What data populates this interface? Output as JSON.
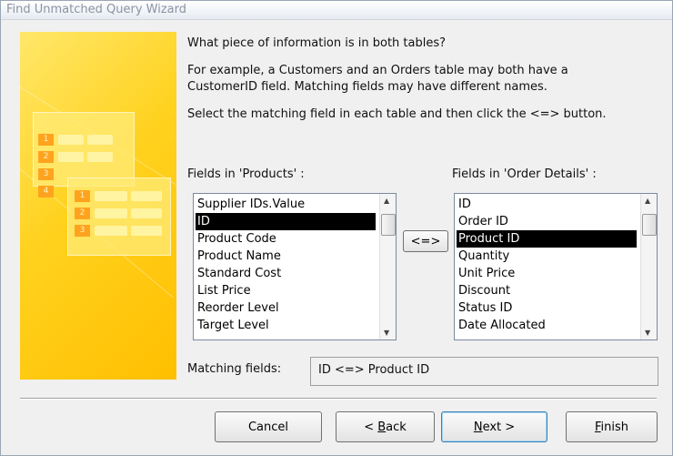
{
  "window": {
    "title": "Find Unmatched Query Wizard"
  },
  "instructions": {
    "heading": "What piece of information is in both tables?",
    "example_line1": "For example, a Customers and an Orders table may both have a",
    "example_line2": "CustomerID field. Matching fields may have different names.",
    "select_line": "Select the matching field in each table and then click the <=> button."
  },
  "left_list": {
    "label": "Fields in 'Products' :",
    "items": [
      "Supplier IDs.Value",
      "ID",
      "Product Code",
      "Product Name",
      "Standard Cost",
      "List Price",
      "Reorder Level",
      "Target Level"
    ],
    "selected_index": 1
  },
  "right_list": {
    "label": "Fields in 'Order Details' :",
    "items": [
      "ID",
      "Order ID",
      "Product ID",
      "Quantity",
      "Unit Price",
      "Discount",
      "Status ID",
      "Date Allocated"
    ],
    "selected_index": 2
  },
  "match_button": {
    "label": "<=>"
  },
  "matching": {
    "label": "Matching fields:",
    "value": "ID <=> Product ID"
  },
  "art": {
    "numbers_left": [
      "1",
      "2",
      "3",
      "4"
    ],
    "numbers_right": [
      "1",
      "2",
      "3"
    ]
  },
  "buttons": {
    "cancel": "Cancel",
    "back_prefix": "< ",
    "back_accel": "B",
    "back_rest": "ack",
    "next_accel": "N",
    "next_rest": "ext >",
    "finish_accel": "F",
    "finish_rest": "inish"
  },
  "colors": {
    "accent_border": "#3c7fb1",
    "selection": "#000000",
    "art_yellow": "#ffd21f"
  }
}
